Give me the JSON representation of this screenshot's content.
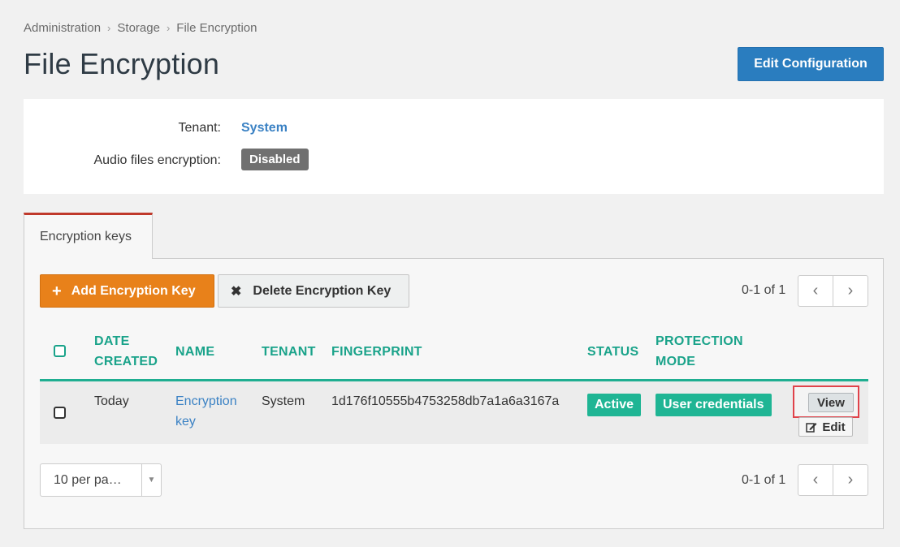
{
  "breadcrumb": [
    "Administration",
    "Storage",
    "File Encryption"
  ],
  "page_title": "File Encryption",
  "edit_config_label": "Edit Configuration",
  "info": {
    "tenant_label": "Tenant:",
    "tenant_value": "System",
    "audio_label": "Audio files encryption:",
    "audio_value": "Disabled"
  },
  "tab_label": "Encryption keys",
  "toolbar": {
    "add_icon": "+",
    "add_label": "Add Encryption Key",
    "delete_icon": "✖",
    "delete_label": "Delete Encryption Key"
  },
  "pager": {
    "top_text": "0-1 of 1",
    "bottom_text": "0-1 of 1",
    "prev_icon": "‹",
    "next_icon": "›"
  },
  "table": {
    "headers": {
      "date_line1": "DATE",
      "date_line2": "CREATED",
      "name": "NAME",
      "tenant": "TENANT",
      "fingerprint": "FINGERPRINT",
      "status": "STATUS",
      "protection_line1": "PROTECTION",
      "protection_line2": "MODE"
    },
    "rows": [
      {
        "date": "Today",
        "name_line1": "Encryption",
        "name_line2": "key",
        "tenant": "System",
        "fingerprint": "1d176f10555b4753258db7a1a6a3167a",
        "status": "Active",
        "protection": "User credentials",
        "view_label": "View",
        "edit_label": "Edit"
      }
    ]
  },
  "per_page_value": "10 per pa…",
  "per_page_arrow": "▼",
  "colors": {
    "accent": "#1aa38a",
    "primary": "#2a7dbf",
    "orange": "#e8811a",
    "tab_top": "#c0392b"
  }
}
